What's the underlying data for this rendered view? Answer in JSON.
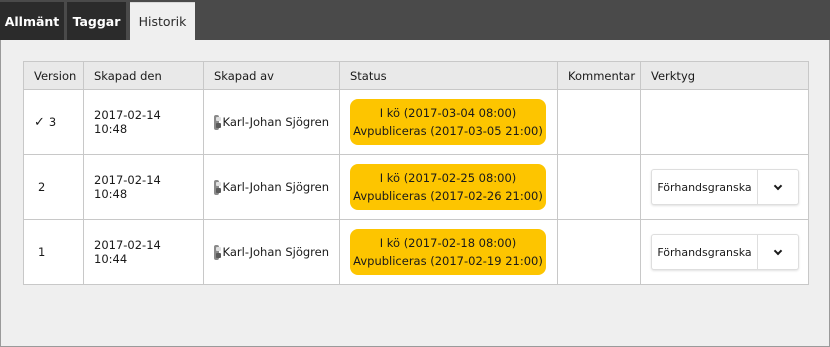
{
  "tabs": [
    {
      "label": "Allmänt"
    },
    {
      "label": "Taggar"
    },
    {
      "label": "Historik"
    }
  ],
  "table": {
    "headers": {
      "version": "Version",
      "created": "Skapad den",
      "created_by": "Skapad av",
      "status": "Status",
      "comment": "Kommentar",
      "tools": "Verktyg"
    },
    "rows": [
      {
        "current_mark": "✓",
        "version": "3",
        "created": "2017-02-14 10:48",
        "created_by": "Karl-Johan Sjögren",
        "status_line1": "I kö (2017-03-04 08:00)",
        "status_line2": "Avpubliceras (2017-03-05 21:00)",
        "comment": "",
        "preview_label": ""
      },
      {
        "current_mark": "",
        "version": "2",
        "created": "2017-02-14 10:48",
        "created_by": "Karl-Johan Sjögren",
        "status_line1": "I kö (2017-02-25 08:00)",
        "status_line2": "Avpubliceras (2017-02-26 21:00)",
        "comment": "",
        "preview_label": "Förhandsgranska"
      },
      {
        "current_mark": "",
        "version": "1",
        "created": "2017-02-14 10:44",
        "created_by": "Karl-Johan Sjögren",
        "status_line1": "I kö (2017-02-18 08:00)",
        "status_line2": "Avpubliceras (2017-02-19 21:00)",
        "comment": "",
        "preview_label": "Förhandsgranska"
      }
    ]
  },
  "icons": {
    "user": "user-icon",
    "dropdown": "chevron-down-icon",
    "current": "check-icon"
  },
  "colors": {
    "status_badge": "#fdc500",
    "tab_dark": "#2b2b2b",
    "panel_bg": "#efefef"
  }
}
